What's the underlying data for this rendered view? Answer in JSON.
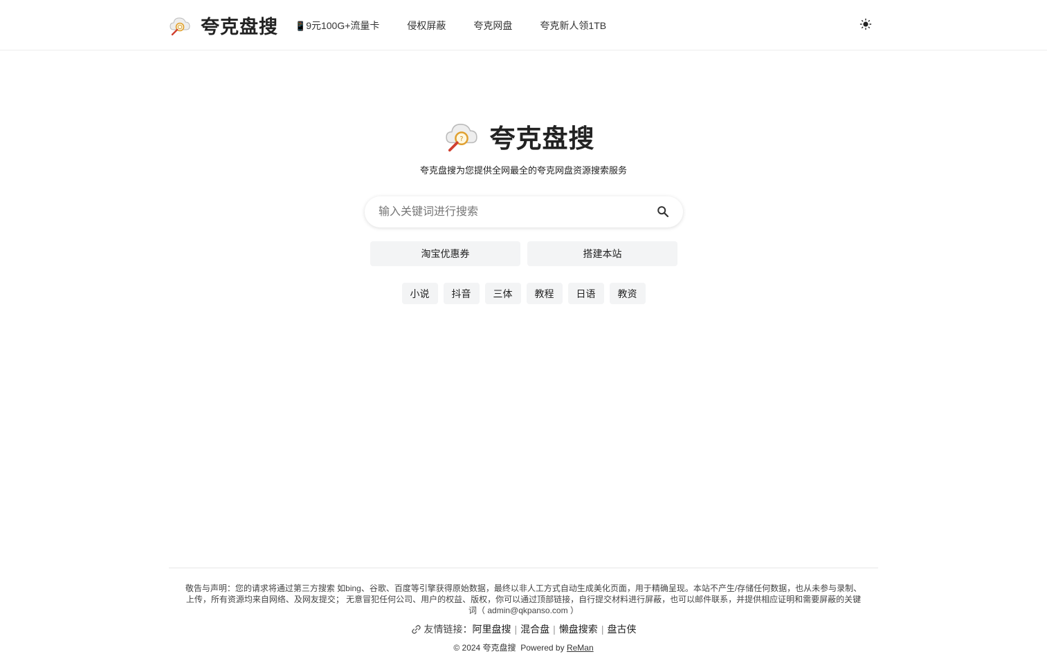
{
  "header": {
    "site_title": "夸克盘搜",
    "nav": [
      {
        "label": "9元100G+流量卡",
        "icon": "mobile-phone-icon"
      },
      {
        "label": "侵权屏蔽"
      },
      {
        "label": "夸克网盘"
      },
      {
        "label": "夸克新人领1TB"
      }
    ],
    "theme_icon": "sun-icon"
  },
  "hero": {
    "title": "夸克盘搜",
    "tagline": "夸克盘搜为您提供全网最全的夸克网盘资源搜索服务"
  },
  "search": {
    "placeholder": "输入关键词进行搜索",
    "value": "",
    "icon": "search-icon"
  },
  "actions": [
    {
      "label": "淘宝优惠券"
    },
    {
      "label": "搭建本站"
    }
  ],
  "tags": [
    "小说",
    "抖音",
    "三体",
    "教程",
    "日语",
    "教资"
  ],
  "footer": {
    "disclaimer": "敬告与声明：您的请求将通过第三方搜索 如bing、谷歌、百度等引擎获得原始数据，最终以非人工方式自动生成美化页面，用于精确呈现。本站不产生/存储任何数据，也从未参与录制、上传，所有资源均来自网络、及网友提交； 无意冒犯任何公司、用户的权益、版权，你可以通过顶部链接，自行提交材料进行屏蔽，也可以邮件联系，并提供相应证明和需要屏蔽的关键词（ admin@qkpanso.com ）",
    "friend_links_label": "友情链接：",
    "friend_links": [
      "阿里盘搜",
      "混合盘",
      "懒盘搜索",
      "盘古侠"
    ],
    "copyright": "© 2024 夸克盘搜",
    "powered_by": "Powered by",
    "powered_link": "ReMan"
  },
  "colors": {
    "text": "#222222",
    "button_bg": "#f3f4f5",
    "divider": "#e6e6e6"
  }
}
